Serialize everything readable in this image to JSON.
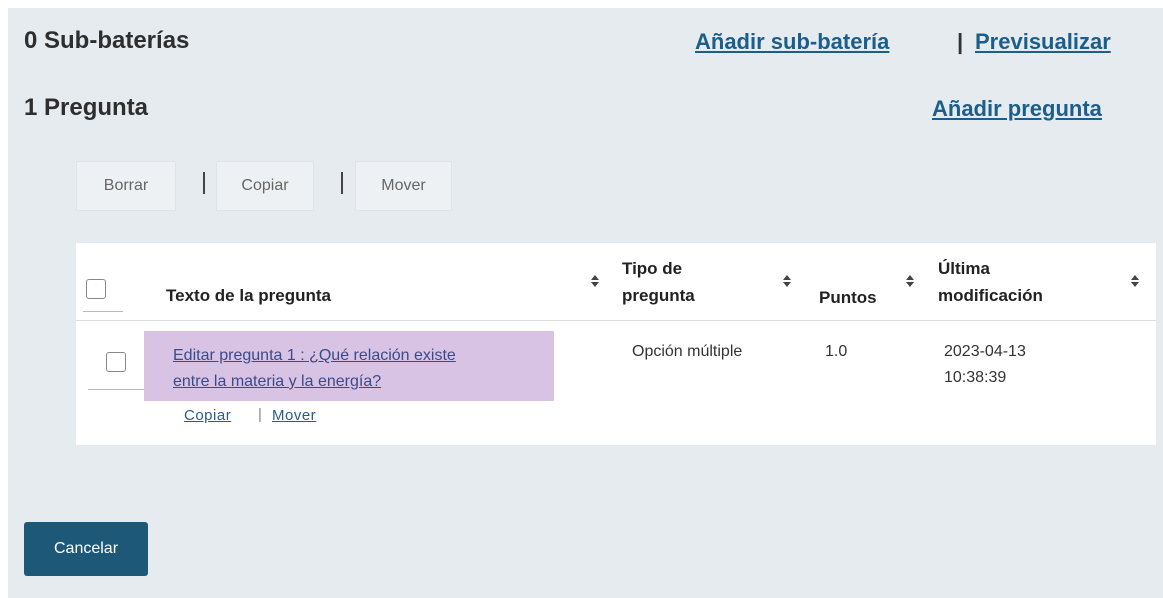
{
  "subbaterias": {
    "title": "0 Sub-baterías",
    "add_link": "Añadir sub-batería",
    "separator": "|",
    "preview_link": "Previsualizar"
  },
  "preguntas": {
    "title": "1 Pregunta",
    "add_link": "Añadir pregunta"
  },
  "toolbar": {
    "delete_label": "Borrar",
    "copy_label": "Copiar",
    "move_label": "Mover"
  },
  "table": {
    "headers": {
      "text": "Texto de la pregunta",
      "type_line1": "Tipo de",
      "type_line2": "pregunta",
      "points": "Puntos",
      "modified_line1": "Última",
      "modified_line2": "modificación"
    },
    "rows": [
      {
        "question_line1": "Editar pregunta 1 : ¿Qué relación existe",
        "question_line2": "entre la materia y la energía?",
        "copy_link": "Copiar",
        "link_separator": "|",
        "move_link": "Mover",
        "type": "Opción múltiple",
        "points": "1.0",
        "date": "2023-04-13",
        "time": "10:38:39"
      }
    ]
  },
  "footer": {
    "cancel_label": "Cancelar"
  },
  "colors": {
    "background": "#e6ebef",
    "link": "#1b5e8c",
    "highlight": "#d8c3e4",
    "cancel_button": "#1e5878"
  }
}
